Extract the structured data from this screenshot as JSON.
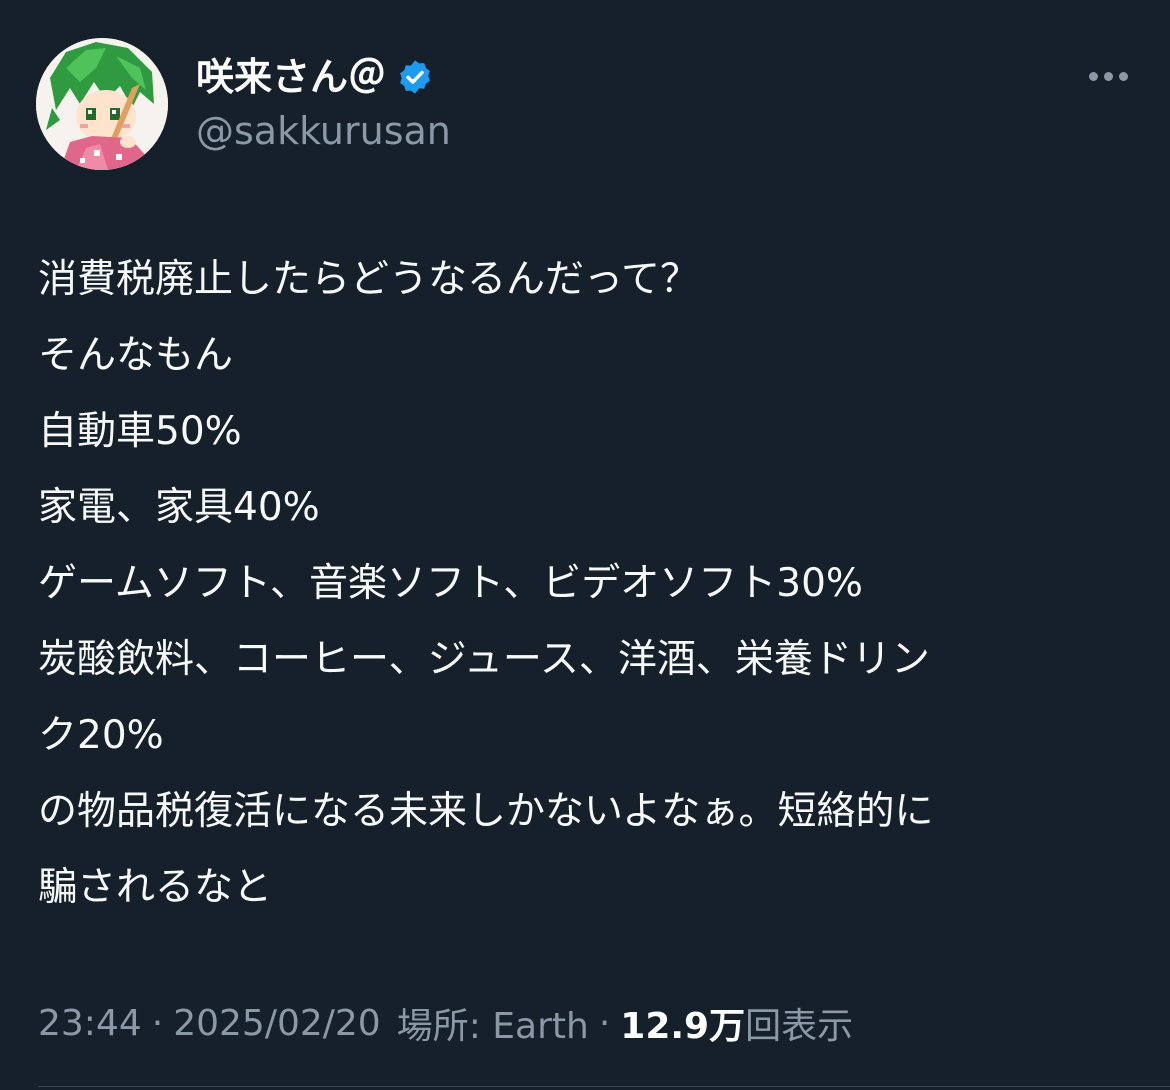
{
  "author": {
    "display_name": "咲来さん＠",
    "handle": "@sakkurusan",
    "verified": true
  },
  "tweet": {
    "lines": [
      "消費税廃止したらどうなるんだって？",
      "そんなもん",
      "自動車50%",
      "家電、家具40%",
      "ゲームソフト、音楽ソフト、ビデオソフト30%",
      "炭酸飲料、コーヒー、ジュース、洋酒、栄養ドリン",
      "ク20%",
      "の物品税復活になる未来しかないよなぁ。短絡的に",
      "騙されるなと"
    ]
  },
  "meta": {
    "time": "23:44",
    "separator": "·",
    "date": "2025/02/20",
    "location_label": "場所: Earth",
    "views_count": "12.9万",
    "views_label": "回表示"
  },
  "colors": {
    "background": "#15202b",
    "text": "#f7f9f9",
    "secondary": "#8b98a5",
    "verified_badge": "#1d9bf0"
  },
  "icons": {
    "verified": "verified-badge-icon",
    "more": "more-options-icon"
  }
}
